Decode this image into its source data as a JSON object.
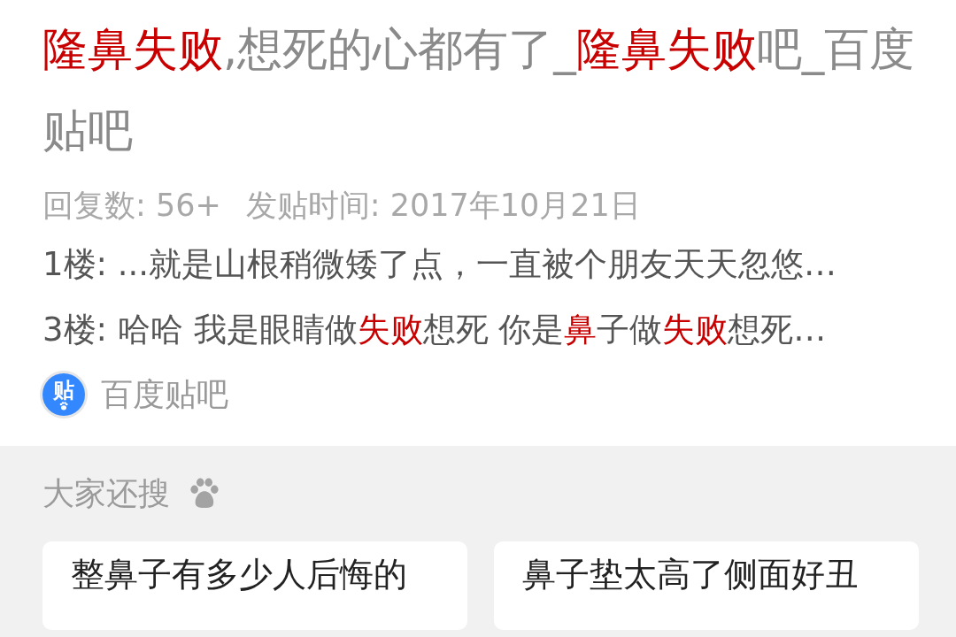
{
  "result": {
    "title": [
      {
        "text": "隆鼻失败",
        "highlight": true
      },
      {
        "text": ",想死的心都有了_",
        "highlight": false
      },
      {
        "text": "隆鼻失败",
        "highlight": true
      },
      {
        "text": "吧_百度贴吧",
        "highlight": false
      }
    ],
    "meta": [
      {
        "label": "回复数:",
        "value": "56+"
      },
      {
        "label": "发贴时间:",
        "value": "2017年10月21日"
      }
    ],
    "snippets": [
      [
        {
          "text": "1楼: ...就是山根稍微矮了点，一直被个朋友天天忽悠…",
          "highlight": false
        }
      ],
      [
        {
          "text": "3楼: 哈哈 我是眼睛做",
          "highlight": false
        },
        {
          "text": "失败",
          "highlight": true
        },
        {
          "text": "想死 你是",
          "highlight": false
        },
        {
          "text": "鼻",
          "highlight": true
        },
        {
          "text": "子做",
          "highlight": false
        },
        {
          "text": "失败",
          "highlight": true
        },
        {
          "text": "想死…",
          "highlight": false
        }
      ]
    ],
    "source": {
      "logo": "贴",
      "name": "百度贴吧"
    }
  },
  "related": {
    "heading": "大家还搜",
    "items": [
      "整鼻子有多少人后悔的",
      "鼻子垫太高了侧面好丑"
    ]
  }
}
